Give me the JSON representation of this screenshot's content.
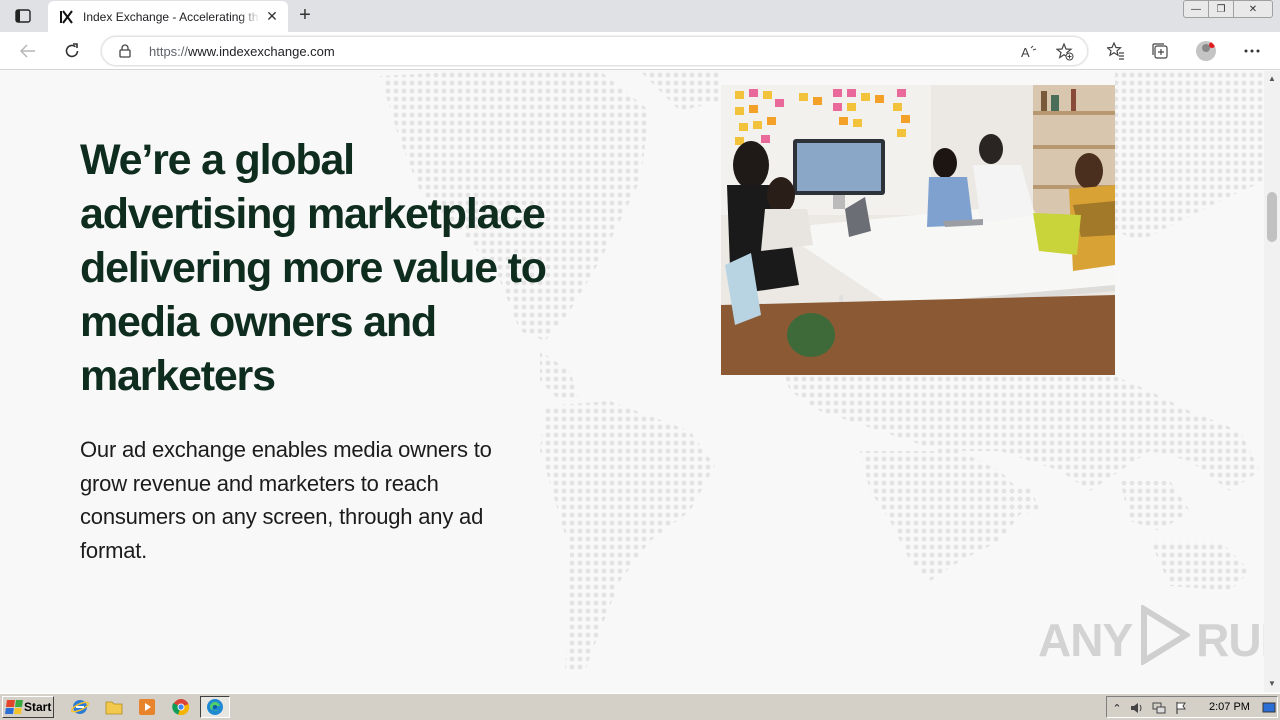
{
  "browser": {
    "tab_title": "Index Exchange - Accelerating the",
    "new_tab_label": "+",
    "url_protocol": "https://",
    "url_host": "www.indexexchange.com",
    "window_controls": {
      "minimize": "—",
      "maximize": "❐",
      "close": "✕"
    }
  },
  "page": {
    "headline": "We’re a global advertising marketplace delivering more value to media owners and marketers",
    "subtext": "Our ad exchange enables media owners to grow revenue and marketers to reach consumers on any screen, through any ad format."
  },
  "watermark": {
    "left": "ANY",
    "right": "RUN"
  },
  "taskbar": {
    "start_label": "Start",
    "clock": "2:07 PM"
  },
  "colors": {
    "headline": "#0f2d1f",
    "page_bg": "#f8f8f8",
    "map_dots": "#e3e3e3"
  }
}
